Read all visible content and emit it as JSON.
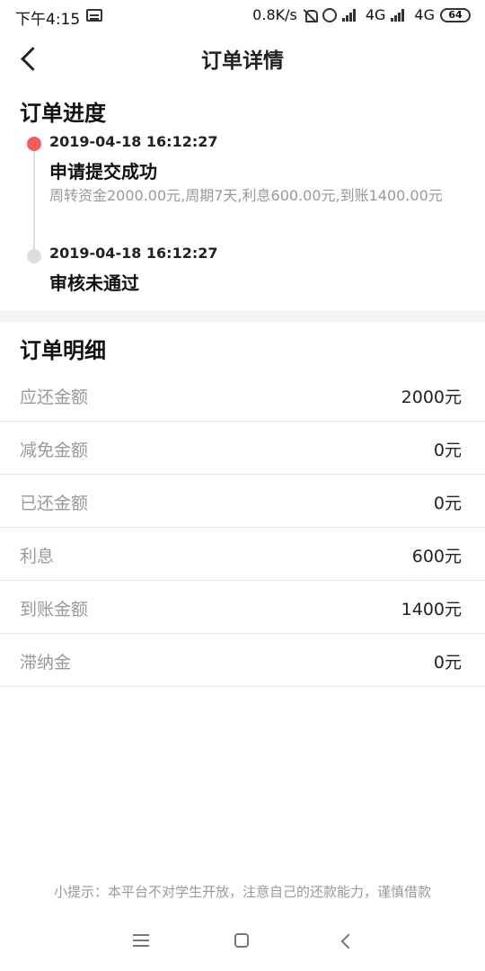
{
  "status_bar": {
    "time": "下午4:15",
    "speed": "0.8K/s",
    "network1": "4G",
    "network2": "4G",
    "battery": "64"
  },
  "header": {
    "title": "订单详情"
  },
  "progress": {
    "title": "订单进度",
    "steps": [
      {
        "time": "2019-04-18 16:12:27",
        "status": "申请提交成功",
        "desc": "周转资金2000.00元,周期7天,利息600.00元,到账1400.00元",
        "color": "#f25d5d"
      },
      {
        "time": "2019-04-18 16:12:27",
        "status": "审核未通过",
        "color": "#dddddd"
      }
    ]
  },
  "detail": {
    "title": "订单明细",
    "rows": [
      {
        "label": "应还金额",
        "value": "2000元"
      },
      {
        "label": "减免金额",
        "value": "0元"
      },
      {
        "label": "已还金额",
        "value": "0元"
      },
      {
        "label": "利息",
        "value": "600元"
      },
      {
        "label": "到账金额",
        "value": "1400元"
      },
      {
        "label": "滞纳金",
        "value": "0元"
      }
    ]
  },
  "tip": "小提示：本平台不对学生开放，注意自己的还款能力，谨慎借款"
}
